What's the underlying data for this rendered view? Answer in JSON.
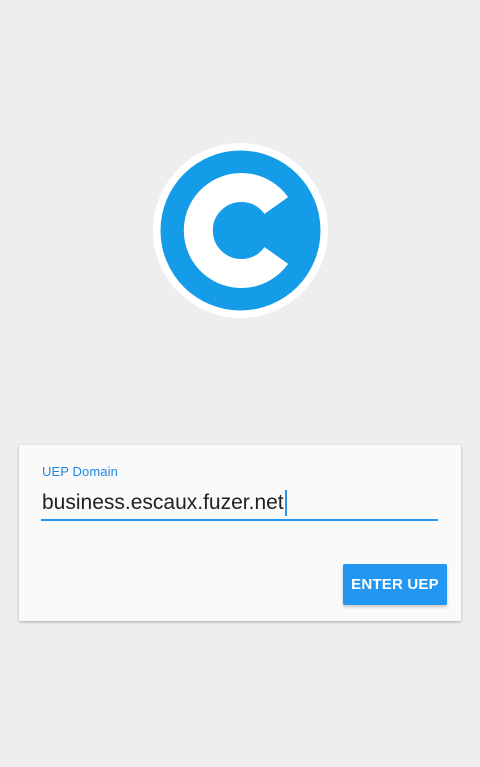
{
  "app": {
    "logo_icon": "escaux-c-logo-icon",
    "brand_color": "#159CE8"
  },
  "form": {
    "domain_label": "UEP Domain",
    "domain_value": "business.escaux.fuzer.net",
    "submit_label": "ENTER UEP",
    "accent_color": "#2196F3"
  }
}
